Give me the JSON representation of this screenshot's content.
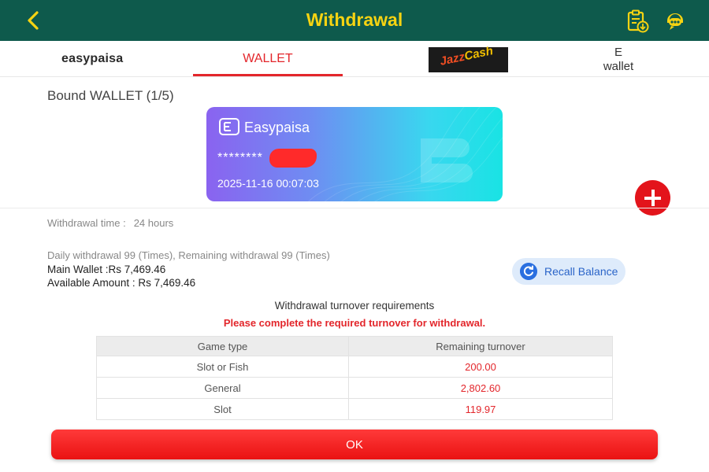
{
  "header": {
    "title": "Withdrawal",
    "back_icon": "chevron-left-icon",
    "record_icon": "clipboard-download-icon",
    "support_icon": "chat-support-icon",
    "bg_color": "#0e5a4c",
    "title_color": "#f6d312"
  },
  "tabs": {
    "easypaisa": "easypaisa",
    "wallet": "WALLET",
    "jazzcash_jazz": "Jazz",
    "jazzcash_cash": "Cash",
    "ewallet_line1": "E",
    "ewallet_line2": "wallet",
    "active": "WALLET"
  },
  "bound": {
    "title": "Bound WALLET (1/5)",
    "card": {
      "name": "Easypaisa",
      "number": "********",
      "date": "2025-11-16 00:07:03"
    }
  },
  "info": {
    "withdrawal_time_label": "Withdrawal time :",
    "withdrawal_time_value": "24 hours",
    "daily": "Daily withdrawal 99 (Times), Remaining withdrawal 99 (Times)",
    "main_wallet": "Main Wallet :Rs 7,469.46",
    "available": "Available Amount : Rs 7,469.46",
    "recall_label": "Recall Balance"
  },
  "turnover": {
    "title": "Withdrawal turnover requirements",
    "warning": "Please complete the required turnover for withdrawal.",
    "headers": [
      "Game type",
      "Remaining turnover"
    ],
    "rows": [
      {
        "game": "Slot or Fish",
        "remaining": "200.00"
      },
      {
        "game": "General",
        "remaining": "2,802.60"
      },
      {
        "game": "Slot",
        "remaining": "119.97"
      }
    ]
  },
  "ok_label": "OK",
  "colors": {
    "accent_red": "#e3262b",
    "recall_blue": "#2a64c8"
  }
}
